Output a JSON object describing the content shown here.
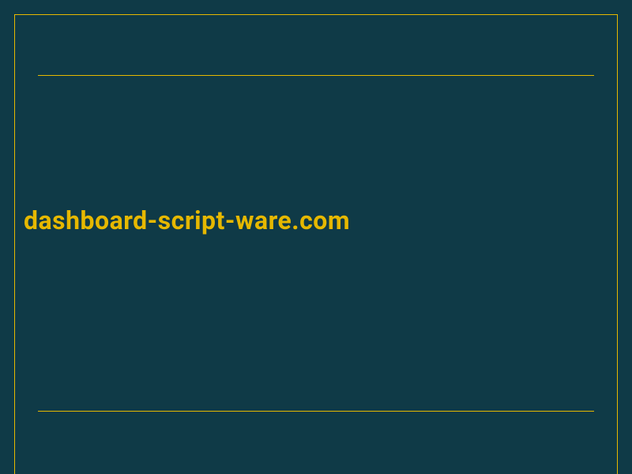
{
  "domain_text": "dashboard-script-ware.com",
  "colors": {
    "background": "#0f3a47",
    "accent": "#e6b800"
  }
}
